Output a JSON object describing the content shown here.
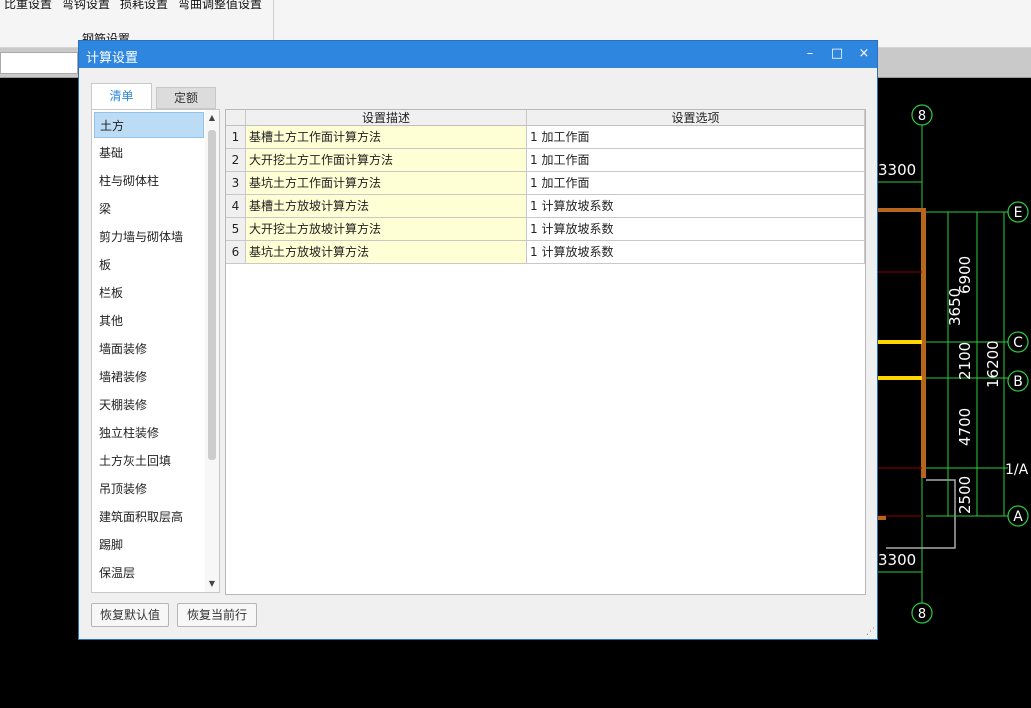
{
  "app": {
    "ribbon_items": [
      "比重设置",
      "弯钩设置",
      "损耗设置",
      "弯曲调整值设置"
    ],
    "ribbon_group": "钢筋设置"
  },
  "dialog": {
    "title": "计算设置",
    "controls": {
      "minimize": "–",
      "maximize": "□",
      "close": "×"
    },
    "tabs": [
      {
        "label": "清单",
        "active": true
      },
      {
        "label": "定额",
        "active": false
      }
    ],
    "categories": [
      "土方",
      "基础",
      "柱与砌体柱",
      "梁",
      "剪力墙与砌体墙",
      "板",
      "栏板",
      "其他",
      "墙面装修",
      "墙裙装修",
      "天棚装修",
      "独立柱装修",
      "土方灰土回填",
      "吊顶装修",
      "建筑面积取层高",
      "踢脚",
      "保温层"
    ],
    "selected_category": "土方",
    "table": {
      "columns": [
        "",
        "设置描述",
        "设置选项"
      ],
      "rows": [
        {
          "no": "1",
          "desc": "基槽土方工作面计算方法",
          "option": "1 加工作面"
        },
        {
          "no": "2",
          "desc": "大开挖土方工作面计算方法",
          "option": "1 加工作面"
        },
        {
          "no": "3",
          "desc": "基坑土方工作面计算方法",
          "option": "1 加工作面"
        },
        {
          "no": "4",
          "desc": "基槽土方放坡计算方法",
          "option": "1 计算放坡系数"
        },
        {
          "no": "5",
          "desc": "大开挖土方放坡计算方法",
          "option": "1 计算放坡系数"
        },
        {
          "no": "6",
          "desc": "基坑土方放坡计算方法",
          "option": "1 计算放坡系数"
        }
      ]
    },
    "buttons": {
      "restore_default": "恢复默认值",
      "restore_row": "恢复当前行"
    }
  },
  "cad": {
    "axis_labels": {
      "top": "8",
      "bottom": "8",
      "e": "E",
      "c": "C",
      "b": "B",
      "a1": "1/A",
      "a": "A"
    },
    "dimensions": {
      "top_width": "3300",
      "bottom_width": "3300",
      "d1": "3650",
      "d2": "6900",
      "d3": "2100",
      "d4": "4700",
      "d5": "2500",
      "total": "16200"
    }
  }
}
